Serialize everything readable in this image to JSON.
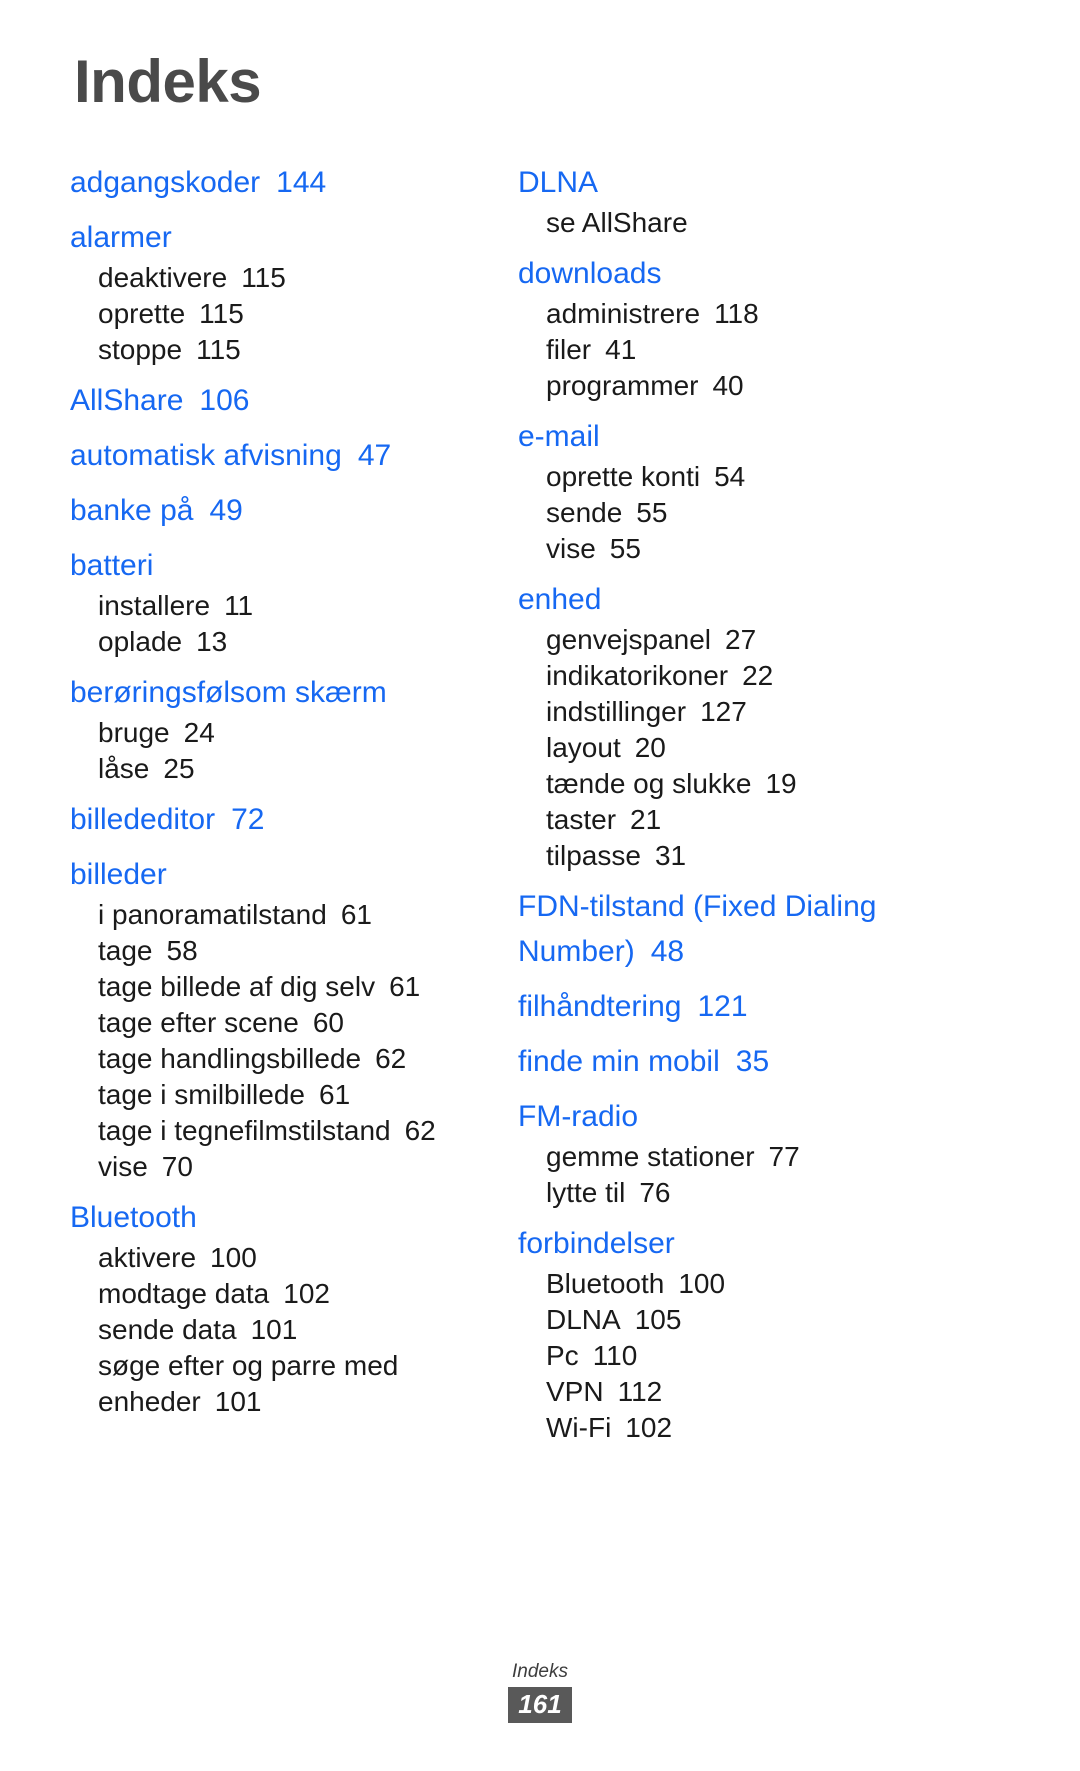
{
  "page": {
    "title": "Indeks",
    "accent_color": "#1668f2",
    "title_color": "#4a4a4a",
    "sub_color": "#1a1a1a",
    "background_color": "#ffffff"
  },
  "footer": {
    "label": "Indeks",
    "page_number": "161",
    "badge_color": "#595959"
  },
  "columns": [
    {
      "name": "left-column",
      "groups": [
        {
          "term": "adgangskoder",
          "page": "144",
          "subentries": []
        },
        {
          "term": "alarmer",
          "page": "",
          "subentries": [
            {
              "term": "deaktivere",
              "page": "115"
            },
            {
              "term": "oprette",
              "page": "115"
            },
            {
              "term": "stoppe",
              "page": "115"
            }
          ]
        },
        {
          "term": "AllShare",
          "page": "106",
          "subentries": []
        },
        {
          "term": "automatisk afvisning",
          "page": "47",
          "subentries": []
        },
        {
          "term": "banke på",
          "page": "49",
          "subentries": []
        },
        {
          "term": "batteri",
          "page": "",
          "subentries": [
            {
              "term": "installere",
              "page": "11"
            },
            {
              "term": "oplade",
              "page": "13"
            }
          ]
        },
        {
          "term": "berøringsfølsom skærm",
          "page": "",
          "subentries": [
            {
              "term": "bruge",
              "page": "24"
            },
            {
              "term": "låse",
              "page": "25"
            }
          ]
        },
        {
          "term": "billededitor",
          "page": "72",
          "subentries": []
        },
        {
          "term": "billeder",
          "page": "",
          "subentries": [
            {
              "term": "i panoramatilstand",
              "page": "61"
            },
            {
              "term": "tage",
              "page": "58"
            },
            {
              "term": "tage billede af dig selv",
              "page": "61"
            },
            {
              "term": "tage efter scene",
              "page": "60"
            },
            {
              "term": "tage handlingsbillede",
              "page": "62"
            },
            {
              "term": "tage i smilbillede",
              "page": "61"
            },
            {
              "term": "tage i tegnefilmstilstand",
              "page": "62"
            },
            {
              "term": "vise",
              "page": "70"
            }
          ]
        },
        {
          "term": "Bluetooth",
          "page": "",
          "subentries": [
            {
              "term": "aktivere",
              "page": "100"
            },
            {
              "term": "modtage data",
              "page": "102"
            },
            {
              "term": "sende data",
              "page": "101"
            },
            {
              "term": "søge efter og parre med enheder",
              "page": "101"
            }
          ]
        }
      ]
    },
    {
      "name": "right-column",
      "groups": [
        {
          "term": "DLNA",
          "page": "",
          "subentries": [
            {
              "term": "se AllShare",
              "page": ""
            }
          ]
        },
        {
          "term": "downloads",
          "page": "",
          "subentries": [
            {
              "term": "administrere",
              "page": "118"
            },
            {
              "term": "filer",
              "page": "41"
            },
            {
              "term": "programmer",
              "page": "40"
            }
          ]
        },
        {
          "term": "e-mail",
          "page": "",
          "subentries": [
            {
              "term": "oprette konti",
              "page": "54"
            },
            {
              "term": "sende",
              "page": "55"
            },
            {
              "term": "vise",
              "page": "55"
            }
          ]
        },
        {
          "term": "enhed",
          "page": "",
          "subentries": [
            {
              "term": "genvejspanel",
              "page": "27"
            },
            {
              "term": "indikatorikoner",
              "page": "22"
            },
            {
              "term": "indstillinger",
              "page": "127"
            },
            {
              "term": "layout",
              "page": "20"
            },
            {
              "term": "tænde og slukke",
              "page": "19"
            },
            {
              "term": "taster",
              "page": "21"
            },
            {
              "term": "tilpasse",
              "page": "31"
            }
          ]
        },
        {
          "term": "FDN-tilstand (Fixed Dialing Number)",
          "page": "48",
          "subentries": []
        },
        {
          "term": "filhåndtering",
          "page": "121",
          "subentries": []
        },
        {
          "term": "finde min mobil",
          "page": "35",
          "subentries": []
        },
        {
          "term": "FM-radio",
          "page": "",
          "subentries": [
            {
              "term": "gemme stationer",
              "page": "77"
            },
            {
              "term": "lytte til",
              "page": "76"
            }
          ]
        },
        {
          "term": "forbindelser",
          "page": "",
          "subentries": [
            {
              "term": "Bluetooth",
              "page": "100"
            },
            {
              "term": "DLNA",
              "page": "105"
            },
            {
              "term": "Pc",
              "page": "110"
            },
            {
              "term": "VPN",
              "page": "112"
            },
            {
              "term": "Wi-Fi",
              "page": "102"
            }
          ]
        }
      ]
    }
  ]
}
